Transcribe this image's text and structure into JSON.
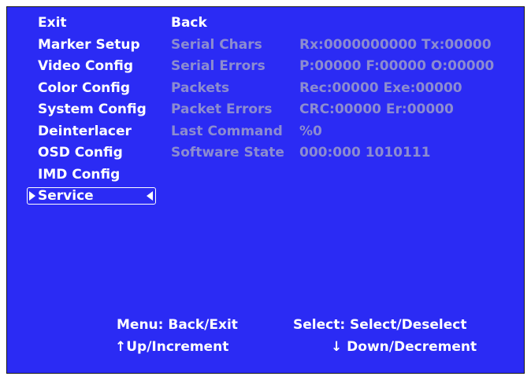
{
  "menu": {
    "items": [
      {
        "label": "Exit"
      },
      {
        "label": "Marker Setup"
      },
      {
        "label": "Video Config"
      },
      {
        "label": "Color Config"
      },
      {
        "label": "System Config"
      },
      {
        "label": "Deinterlacer"
      },
      {
        "label": "OSD Config"
      },
      {
        "label": "IMD Config"
      },
      {
        "label": "Service",
        "selected": true
      }
    ]
  },
  "service_panel": {
    "back_label": "Back",
    "rows": [
      {
        "label": "Serial Chars",
        "value": "Rx:0000000000 Tx:00000"
      },
      {
        "label": "Serial Errors",
        "value": "P:00000 F:00000 O:00000"
      },
      {
        "label": "Packets",
        "value": "Rec:00000 Exe:00000"
      },
      {
        "label": "Packet Errors",
        "value": "CRC:00000 Er:00000"
      },
      {
        "label": "Last Command",
        "value": "%0"
      },
      {
        "label": "Software State",
        "value": "000:000 1010111"
      }
    ]
  },
  "footer": {
    "menu_hint": "Menu: Back/Exit",
    "select_hint": "Select: Select/Deselect",
    "up_hint": "↑Up/Increment",
    "down_hint": "↓ Down/Decrement"
  },
  "colors": {
    "background": "#2b2bf4",
    "active_text": "#ffffff",
    "inactive_text": "#8c8cd0"
  }
}
